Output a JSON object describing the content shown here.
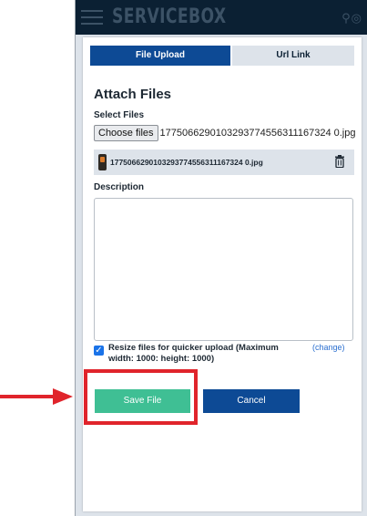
{
  "header": {
    "brand": "SERVICEBOX",
    "icons": [
      "menu-icon",
      "search-icon",
      "settings-icon"
    ]
  },
  "tabs": [
    {
      "label": "File Upload",
      "active": true
    },
    {
      "label": "Url Link",
      "active": false
    }
  ],
  "form": {
    "title": "Attach Files",
    "select_label": "Select Files",
    "choose_button": "Choose files",
    "chosen_file": "1775066290103293774556311167324 0.jpg",
    "attached_file": "1775066290103293774556311167324 0.jpg",
    "description_label": "Description",
    "description_value": "",
    "resize_label": "Resize files for quicker upload (Maximum width: 1000: height: 1000)",
    "resize_checked": true,
    "change_link": "(change)",
    "save_button": "Save File",
    "cancel_button": "Cancel"
  },
  "colors": {
    "header_bg": "#0b2033",
    "primary": "#0d4a95",
    "save": "#3fbf94",
    "highlight": "#e0242b"
  }
}
